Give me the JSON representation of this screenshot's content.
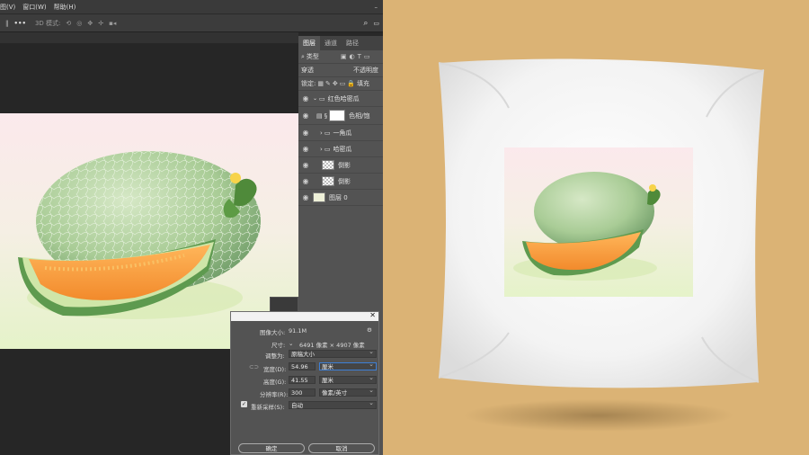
{
  "menu": [
    "图(V)",
    "窗口(W)",
    "帮助(H)"
  ],
  "options": {
    "mode_label": "3D 模式:"
  },
  "layers_panel": {
    "tabs": [
      "图层",
      "通道",
      "路径"
    ],
    "filter_kind": "类型",
    "blend_mode": "穿透",
    "opacity_label": "不透明度",
    "lock_label": "锁定:",
    "fill_label": "填充",
    "layers": [
      {
        "name": "红色哈密瓜",
        "kind": "group-open"
      },
      {
        "name": "色相/饱",
        "kind": "adjustment"
      },
      {
        "name": "一角瓜",
        "kind": "group"
      },
      {
        "name": "哈密瓜",
        "kind": "group"
      },
      {
        "name": "倒影",
        "kind": "pixel"
      },
      {
        "name": "倒影",
        "kind": "pixel"
      },
      {
        "name": "图层 0",
        "kind": "pixel"
      }
    ]
  },
  "dialog": {
    "image_size_label": "图像大小:",
    "image_size_value": "91.1M",
    "dimensions_label": "尺寸:",
    "dimensions_value": "6491 像素 × 4907 像素",
    "fit_label": "调整为:",
    "fit_value": "原稿大小",
    "width_label": "宽度(D):",
    "width_value": "54.96",
    "width_unit": "厘米",
    "height_label": "高度(G):",
    "height_value": "41.55",
    "height_unit": "厘米",
    "resolution_label": "分辨率(R):",
    "resolution_value": "300",
    "resolution_unit": "像素/英寸",
    "resample_label": "重新采样(S):",
    "resample_value": "自动",
    "ok_label": "确定",
    "cancel_label": "取消"
  },
  "colors": {
    "background_right": "#dbb375",
    "ps_dark": "#282828",
    "panel": "#535353",
    "melon_orange": "#f5a34a",
    "melon_green": "#a9cc96"
  }
}
